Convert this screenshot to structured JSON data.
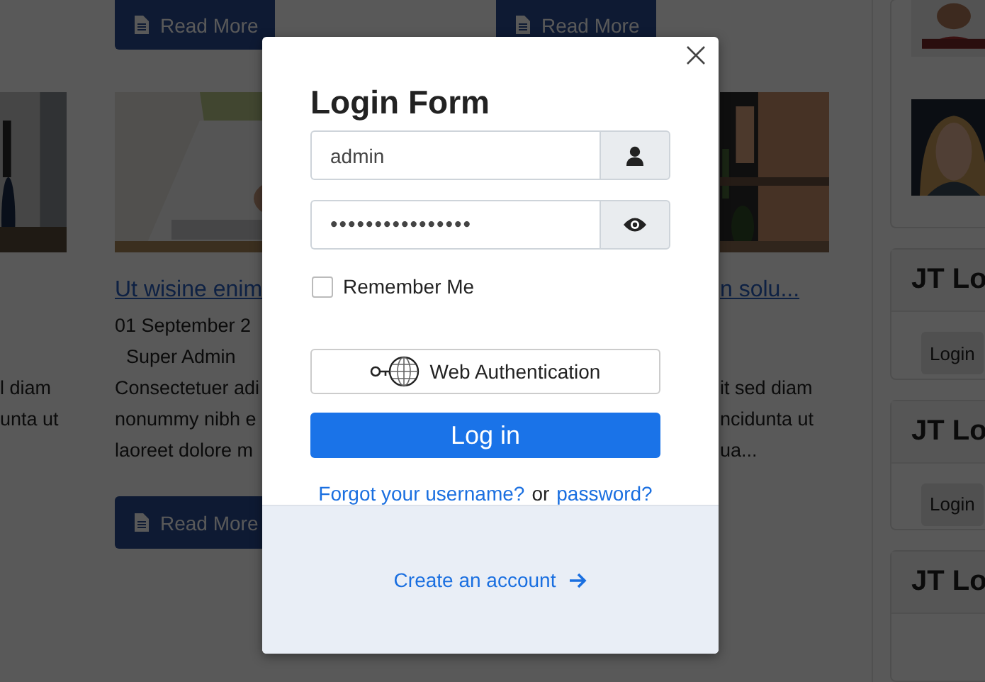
{
  "background_page": {
    "top_row": [
      {
        "read_more": "Read More"
      },
      {
        "read_more": "Read More"
      }
    ],
    "articles": [
      {
        "picture": {
          "kind": "picture"
        },
        "excerpt": [
          "l diam",
          "unta ut"
        ]
      },
      {
        "picture": {
          "kind": "picture"
        },
        "title": "Ut wisine enim",
        "date": "01 September 2",
        "author": "Super Admin",
        "excerpt": [
          "Consectetuer adi",
          "nonummy nibh e",
          "laoreet dolore m"
        ],
        "read_more": "Read More"
      },
      {
        "picture": {
          "kind": "picture"
        },
        "title": "n solu...",
        "excerpt": [
          "it sed diam",
          "ncidunta ut",
          "ua..."
        ]
      }
    ],
    "sidebar": {
      "photos": [
        {
          "kind": "picture"
        },
        {
          "kind": "picture"
        }
      ],
      "modules": [
        {
          "title": "JT Lo",
          "button": "Login"
        },
        {
          "title": "JT Lo",
          "button": "Login"
        },
        {
          "title": "JT Lo"
        }
      ]
    }
  },
  "login_modal": {
    "title": "Login Form",
    "username": {
      "value": "admin"
    },
    "password": {
      "value": "••••••••••••••••"
    },
    "remember": {
      "label": "Remember Me",
      "checked": false
    },
    "webauthn_button": "Web Authentication",
    "login_button": "Log in",
    "forgot_username": "Forgot your username?",
    "or": "or",
    "forgot_password": "password?",
    "create_account": "Create an account"
  }
}
